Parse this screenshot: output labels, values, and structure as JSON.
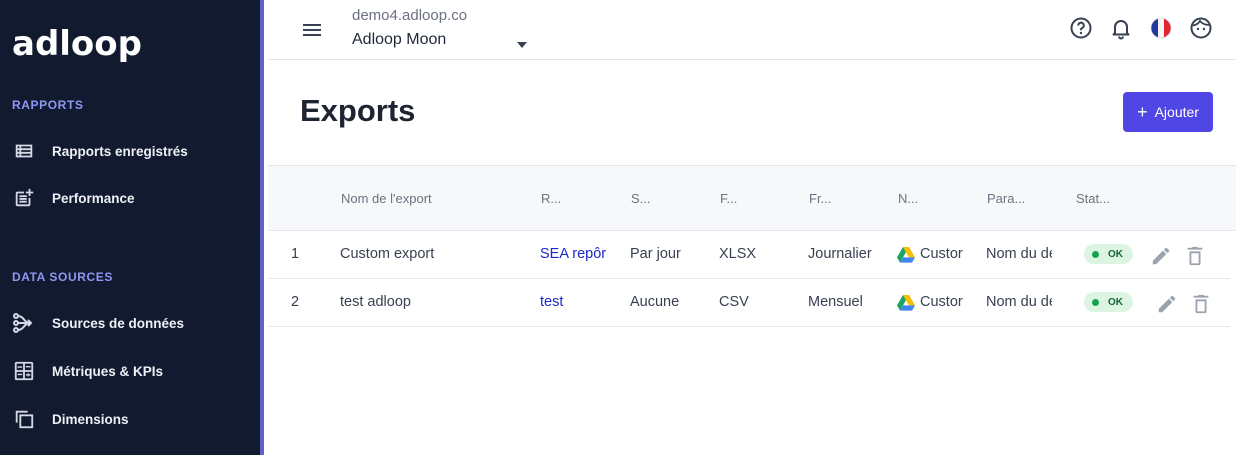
{
  "brand": {
    "logo_text": "adloop"
  },
  "sidebar": {
    "sections": [
      {
        "title": "RAPPORTS",
        "items": [
          {
            "label": "Rapports enregistrés",
            "icon": "list-icon"
          },
          {
            "label": "Performance",
            "icon": "post-add-icon"
          }
        ]
      },
      {
        "title": "DATA SOURCES",
        "items": [
          {
            "label": "Sources de données",
            "icon": "merge-icon"
          },
          {
            "label": "Métriques & KPIs",
            "icon": "calculator-icon"
          },
          {
            "label": "Dimensions",
            "icon": "copy-icon"
          }
        ]
      }
    ]
  },
  "header": {
    "account_domain": "demo4.adloop.co",
    "account_name": "Adloop Moon",
    "icons": [
      "help-icon",
      "bell-icon",
      "france-flag-icon",
      "user-face-icon"
    ]
  },
  "page": {
    "title": "Exports",
    "add_button": "Ajouter"
  },
  "table": {
    "columns": [
      "Nom de l'export",
      "R...",
      "S...",
      "F...",
      "Fr...",
      "N...",
      "Para...",
      "Stat..."
    ],
    "rows": [
      {
        "num": "1",
        "name": "Custom export",
        "report": "SEA repôr",
        "schedule": "Par jour",
        "format": "XLSX",
        "frequency": "Journalier",
        "destination": "Custor",
        "params": "Nom du de",
        "status": "OK"
      },
      {
        "num": "2",
        "name": "test adloop",
        "report": "test",
        "schedule": "Aucune",
        "format": "CSV",
        "frequency": "Mensuel",
        "destination": "Custor",
        "params": "Nom du de",
        "status": "OK"
      }
    ]
  },
  "colors": {
    "sidebar_bg": "#111a2e",
    "sidebar_section": "#8f97f5",
    "accent": "#4f46e5",
    "link": "#1d28c8",
    "status_ok_bg": "#dcf5e3",
    "status_ok_dot": "#16a34a"
  }
}
